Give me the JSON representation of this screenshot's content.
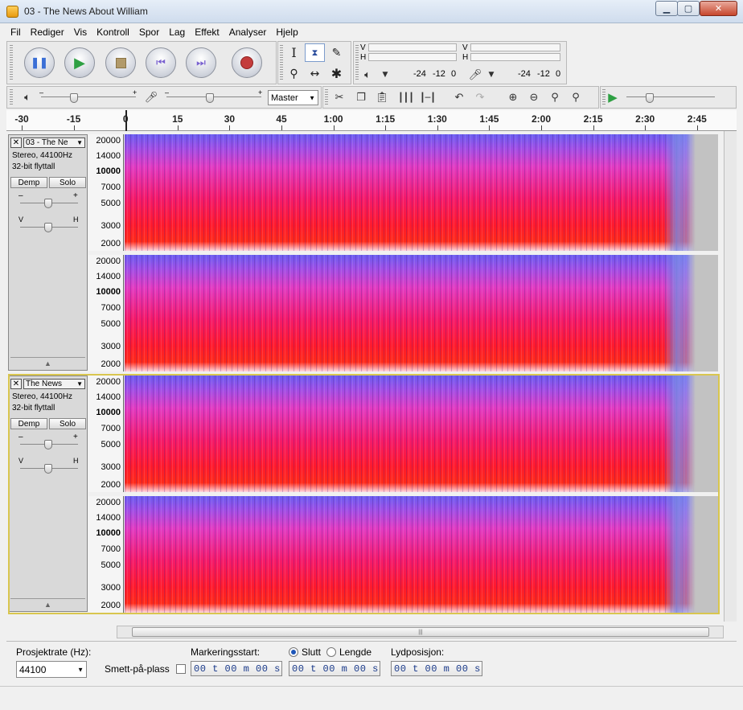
{
  "window": {
    "title": "03 - The News About William",
    "colors": {
      "titlebar": "#cfdced",
      "accent": "#1d56b8",
      "selection_border": "#d9c64f"
    }
  },
  "menu": [
    "Fil",
    "Rediger",
    "Vis",
    "Kontroll",
    "Spor",
    "Lag",
    "Effekt",
    "Analyser",
    "Hjelp"
  ],
  "transport": {
    "buttons": [
      "pause-icon",
      "play-icon",
      "stop-icon",
      "skip-start-icon",
      "skip-end-icon",
      "record-icon"
    ]
  },
  "tools": [
    "selection-icon",
    "envelope-icon",
    "draw-icon",
    "zoom-icon",
    "timeshift-icon",
    "multi-tool-icon"
  ],
  "meters": {
    "playback": {
      "v": "V",
      "h": "H",
      "scale": [
        "-24",
        "-12",
        "0"
      ]
    },
    "record": {
      "v": "V",
      "h": "H",
      "scale": [
        "-24",
        "-12",
        "0"
      ]
    }
  },
  "mixer": {
    "source": "Master"
  },
  "ruler": {
    "labels": [
      "-30",
      "-15",
      "0",
      "15",
      "30",
      "45",
      "1:00",
      "1:15",
      "1:30",
      "1:45",
      "2:00",
      "2:15",
      "2:30",
      "2:45"
    ]
  },
  "tracks": [
    {
      "name": "03 - The Ne",
      "info1": "Stereo, 44100Hz",
      "info2": "32-bit flyttall",
      "mute": "Demp",
      "solo": "Solo",
      "gain_minus": "–",
      "gain_plus": "+",
      "pan_left": "V",
      "pan_right": "H",
      "selected": false
    },
    {
      "name": "The News",
      "info1": "Stereo, 44100Hz",
      "info2": "32-bit flyttall",
      "mute": "Demp",
      "solo": "Solo",
      "gain_minus": "–",
      "gain_plus": "+",
      "pan_left": "V",
      "pan_right": "H",
      "selected": true
    }
  ],
  "freq_axis": [
    "20000",
    "14000",
    "10000",
    "7000",
    "5000",
    "3000",
    "2000"
  ],
  "selection_bar": {
    "rate_label": "Prosjektrate (Hz):",
    "rate_value": "44100",
    "snap_label": "Smett-på-plass",
    "start_label": "Markeringsstart:",
    "end_label": "Slutt",
    "length_label": "Lengde",
    "pos_label": "Lydposisjon:",
    "time_start": "00 t 00 m 00 s",
    "time_end": "00 t 00 m 00 s",
    "time_pos": "00 t 00 m 00 s"
  }
}
